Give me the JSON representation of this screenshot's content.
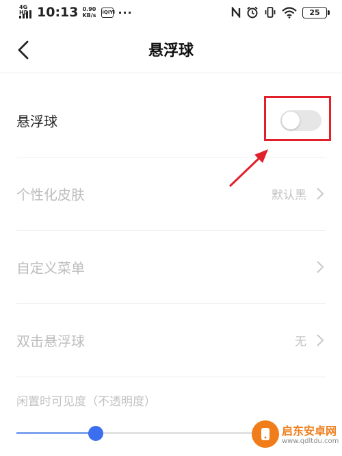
{
  "status_bar": {
    "network": "4G HD",
    "time": "10:13",
    "speed_value": "0.90",
    "speed_unit": "KB/s",
    "app_icon_text": "iQIYI",
    "more": "···",
    "icons": [
      "nfc-icon",
      "alarm-icon",
      "vibrate-icon",
      "wifi-icon"
    ],
    "battery": "25"
  },
  "header": {
    "title": "悬浮球",
    "back_icon": "chevron-left-icon"
  },
  "settings": {
    "floating_ball": {
      "label": "悬浮球",
      "enabled": false
    },
    "skin": {
      "label": "个性化皮肤",
      "value": "默认黑"
    },
    "custom_menu": {
      "label": "自定义菜单"
    },
    "double_tap": {
      "label": "双击悬浮球",
      "value": "无"
    },
    "idle_opacity": {
      "label": "闲置时可见度（不透明度）",
      "level_percent": 33
    }
  },
  "colors": {
    "highlight": "#e0202a",
    "slider_thumb": "#3b6ff0",
    "watermark": "#f07d1a"
  },
  "watermark": {
    "text": "启东安卓网",
    "url": "www.qdltdu.com"
  }
}
